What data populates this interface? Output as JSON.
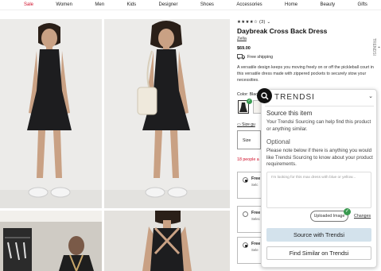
{
  "nav": [
    "Sale",
    "Women",
    "Men",
    "Kids",
    "Designer",
    "Shoes",
    "Accessories",
    "Home",
    "Beauty",
    "Gifts"
  ],
  "product": {
    "stars": "★★★★☆",
    "rating_count": "(3)",
    "title": "Daybreak Cross Back Dress",
    "brand": "Zella",
    "price": "$69.00",
    "shipping": "Free shipping",
    "description": "A versatile design keeps you moving freely on or off the pickleball court in this versatile dress made with zippered pockets to securely stow your necessities.",
    "color_label": "Color: Blac",
    "size_guide": "Size gu",
    "size_label": "Size",
    "people_alert": "18 people a",
    "options": [
      {
        "label": "Free",
        "sub": "Selc"
      },
      {
        "label": "Free",
        "sub": "Selec"
      },
      {
        "label": "Free",
        "sub": "Sele"
      }
    ],
    "side_tab": "TRENDSI"
  },
  "popup": {
    "logo": "TRENDSI",
    "heading": "Source this item",
    "text": "Your Trendsi Sourcing can help find this product or anything similar.",
    "optional_heading": "Optional",
    "optional_text": "Please note below if there is anything you would like Trendsi Sourcing to know about your product requirements.",
    "textarea_placeholder": "I'm looking for this max dress with blue or yellow...",
    "uploaded_label": "Uploaded Image",
    "changes_label": "Changes",
    "source_button": "Source with Trendsi",
    "similar_button": "Find Similar on Trendsi",
    "accent": "#d3e2ec"
  }
}
